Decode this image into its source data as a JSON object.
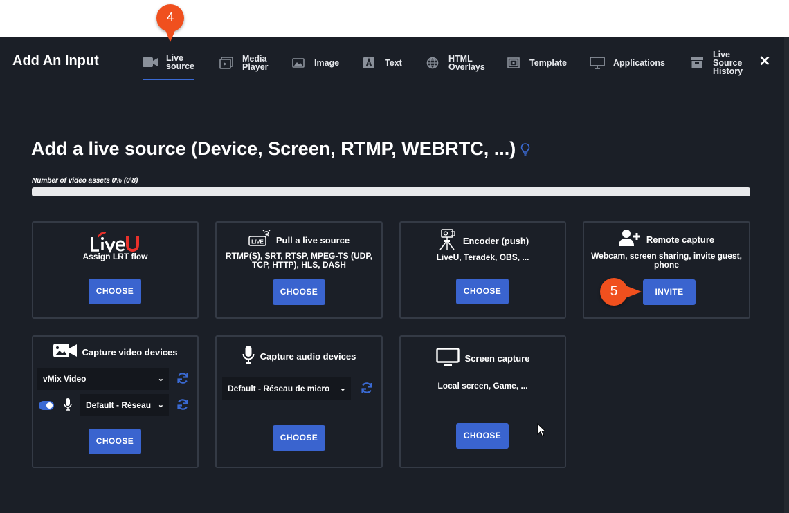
{
  "header": {
    "title": "Add An Input",
    "close_label": "✕"
  },
  "tabs": [
    {
      "label": "Live\nsource",
      "icon": "camera-icon",
      "active": true
    },
    {
      "label": "Media\nPlayer",
      "icon": "media-player-icon"
    },
    {
      "label": "Image",
      "icon": "image-icon"
    },
    {
      "label": "Text",
      "icon": "text-icon"
    },
    {
      "label": "HTML\nOverlays",
      "icon": "globe-icon"
    },
    {
      "label": "Template",
      "icon": "template-icon"
    },
    {
      "label": "Applications",
      "icon": "monitor-icon"
    },
    {
      "label": "Live\nSource\nHistory",
      "icon": "archive-icon"
    }
  ],
  "main": {
    "heading": "Add a live source (Device, Screen, RTMP, WEBRTC, ...)",
    "progress_label": "Number of video assets 0% (0\\8)",
    "progress_percent": 0
  },
  "cards": {
    "liveu": {
      "logo_text": "LiveU",
      "subtitle": "Assign LRT flow",
      "button": "CHOOSE"
    },
    "pull": {
      "title": "Pull a live source",
      "icon_text": "LIVE",
      "subtitle": "RTMP(S), SRT, RTSP, MPEG-TS (UDP, TCP, HTTP), HLS, DASH",
      "button": "CHOOSE"
    },
    "encoder": {
      "title": "Encoder (push)",
      "subtitle": "LiveU, Teradek, OBS, ...",
      "button": "CHOOSE"
    },
    "remote": {
      "title": "Remote capture",
      "subtitle": "Webcam, screen sharing, invite guest, phone",
      "button": "INVITE"
    },
    "video": {
      "title": "Capture video devices",
      "video_select": "vMix Video",
      "audio_select": "Default - Réseau",
      "audio_enabled": true,
      "button": "CHOOSE"
    },
    "audio": {
      "title": "Capture audio devices",
      "select": "Default - Réseau de micro",
      "button": "CHOOSE"
    },
    "screen": {
      "title": "Screen capture",
      "subtitle": "Local screen, Game, ...",
      "button": "CHOOSE"
    }
  },
  "annotations": {
    "step_4": "4",
    "step_5": "5"
  },
  "colors": {
    "background": "#1b1f27",
    "accent": "#3a64cf",
    "marker": "#f0501e",
    "liveu_red": "#e8312b"
  }
}
